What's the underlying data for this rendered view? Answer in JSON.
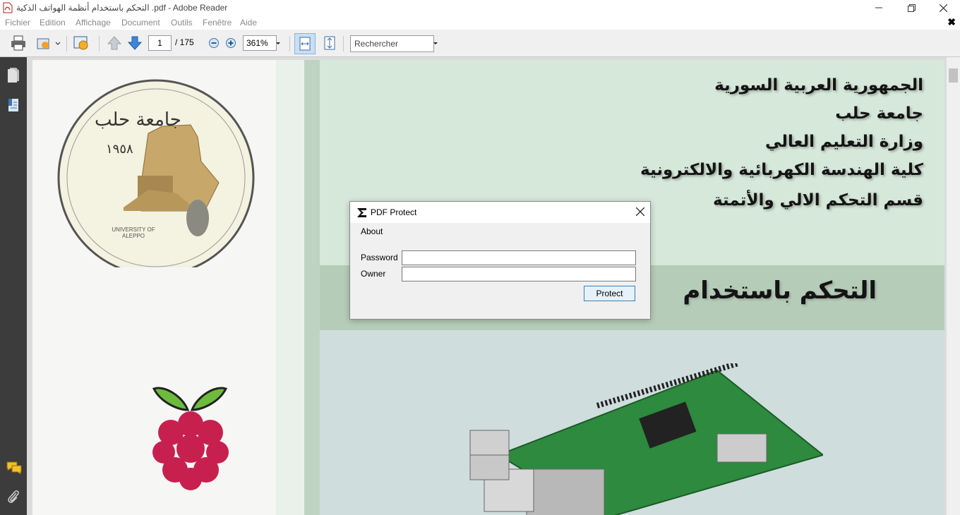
{
  "window": {
    "title": "التحكم باستخدام أنظمة الهواتف الذكية .pdf - Adobe Reader",
    "minimize_icon": "minimize-icon",
    "maximize_icon": "restore-icon",
    "close_icon": "close-icon"
  },
  "menu": {
    "items": [
      "Fichier",
      "Edition",
      "Affichage",
      "Document",
      "Outils",
      "Fenêtre",
      "Aide"
    ],
    "close_doc": "✖"
  },
  "toolbar": {
    "page_current": "1",
    "page_total": "/ 175",
    "zoom": "361%",
    "search_placeholder": "Rechercher"
  },
  "document": {
    "header_lines": [
      "الجمهورية العربية السورية",
      "جامعة حلب",
      "وزارة التعليم العالي",
      "كلية الهندسة الكهربائية والالكترونية",
      "قسم التحكم الالي والأتمتة"
    ],
    "banner_text": "التحكم باستخدام",
    "logo_top": "جامعة حلب",
    "logo_year": "١٩٥٨",
    "logo_bottom": "UNIVERSITY OF ALEPPO"
  },
  "dialog": {
    "title": "PDF Protect",
    "menu_about": "About",
    "password_label": "Password",
    "owner_label": "Owner",
    "password_value": "",
    "owner_value": "",
    "protect_button": "Protect"
  },
  "colors": {
    "banner_band": "#b5cdb8",
    "page_green": "#d6e8da",
    "left_panel": "#3c3c3c",
    "raspberry": "#c7204f",
    "leaf": "#6dbb3c"
  }
}
